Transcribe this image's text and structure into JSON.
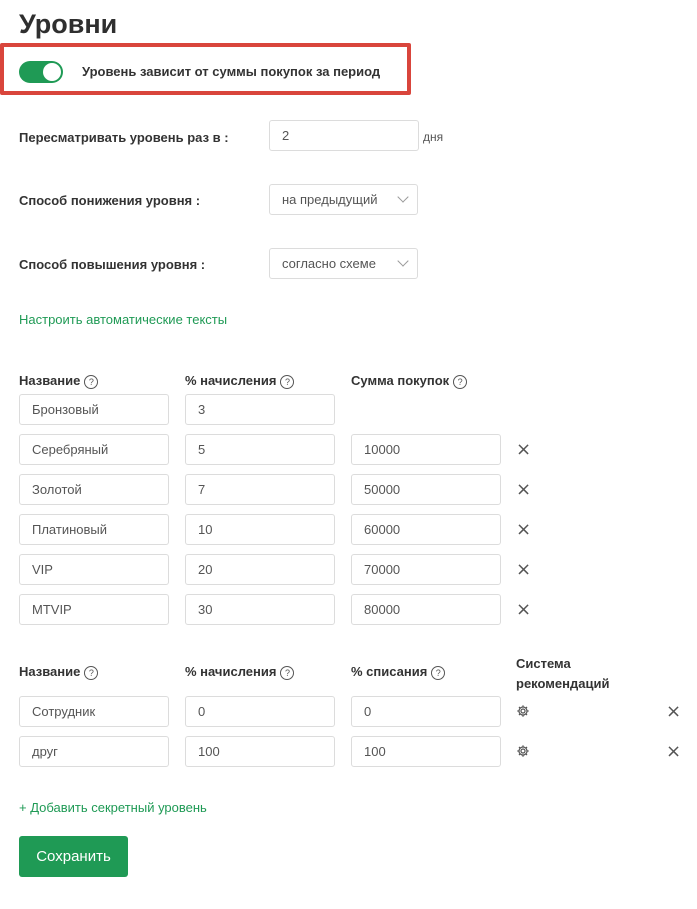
{
  "page": {
    "title": "Уровни",
    "toggle_label": "Уровень зависит от суммы покупок за период",
    "toggle_on": true
  },
  "settings": {
    "review_label": "Пересматривать уровень раз в :",
    "review_value": "2",
    "review_suffix": "дня",
    "lower_label": "Способ понижения уровня :",
    "lower_value": "на предыдущий",
    "raise_label": "Способ повышения уровня :",
    "raise_value": "согласно схеме",
    "auto_texts_link": "Настроить автоматические тексты"
  },
  "levels_table": {
    "headers": [
      "Название",
      "% начисления",
      "Сумма покупок"
    ],
    "help_glyph": "?",
    "remove_glyph": "×",
    "rows": [
      {
        "name": "Бронзовый",
        "percent": "3",
        "sum": ""
      },
      {
        "name": "Серебряный",
        "percent": "5",
        "sum": "10000"
      },
      {
        "name": "Золотой",
        "percent": "7",
        "sum": "50000"
      },
      {
        "name": "Платиновый",
        "percent": "10",
        "sum": "60000"
      },
      {
        "name": "VIP",
        "percent": "20",
        "sum": "70000"
      },
      {
        "name": "MTVIP",
        "percent": "30",
        "sum": "80000"
      }
    ]
  },
  "secret_table": {
    "headers": [
      "Название",
      "% начисления",
      "% списания"
    ],
    "referral_header": "Система рекомендаций",
    "rows": [
      {
        "name": "Сотрудник",
        "percent": "0",
        "writeoff": "0"
      },
      {
        "name": "друг",
        "percent": "100",
        "writeoff": "100"
      }
    ]
  },
  "actions": {
    "add_secret_link": "+ Добавить секретный уровень",
    "save_label": "Сохранить"
  },
  "colors": {
    "accent": "#1f9a55",
    "highlight_border": "#d9453c"
  }
}
